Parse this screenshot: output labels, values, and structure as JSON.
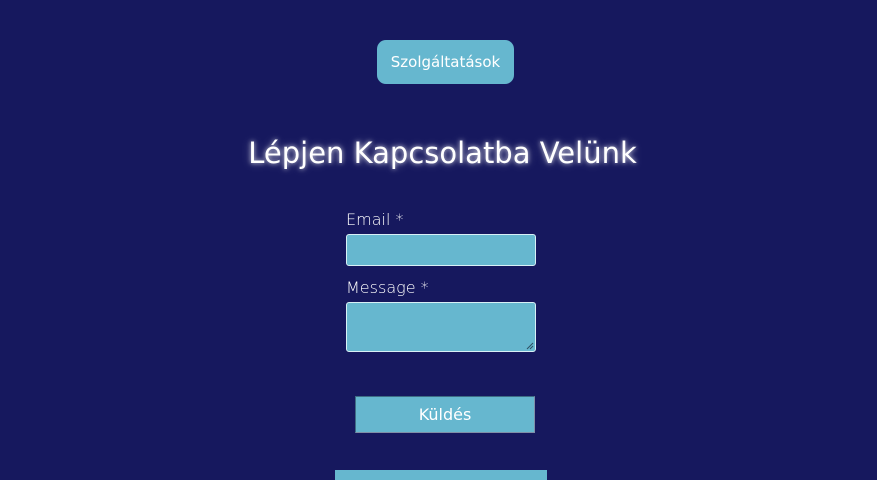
{
  "header": {
    "top_fragment": "' ' '"
  },
  "navigation": {
    "services_button_label": "Szolgáltatások"
  },
  "contact": {
    "title": "Lépjen Kapcsolatba Velünk",
    "email_label": "Email *",
    "email_value": "",
    "message_label": "Message *",
    "message_value": "",
    "submit_label": "Küldés"
  },
  "colors": {
    "background": "#16185e",
    "accent": "#66b7cf",
    "text": "#ffffff"
  }
}
